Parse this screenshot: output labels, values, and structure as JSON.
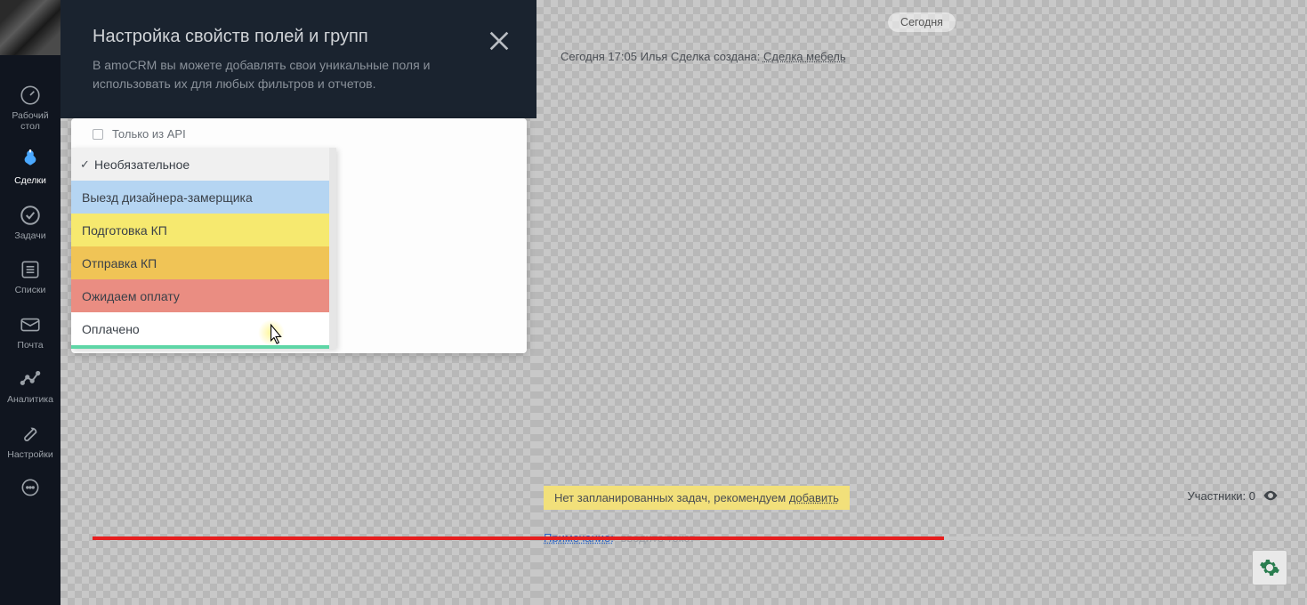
{
  "sidebar": {
    "items": [
      {
        "label": "Рабочий\nстол"
      },
      {
        "label": "Сделки"
      },
      {
        "label": "Задачи"
      },
      {
        "label": "Списки"
      },
      {
        "label": "Почта"
      },
      {
        "label": "Аналитика"
      },
      {
        "label": "Настройки"
      },
      {
        "label": ""
      }
    ]
  },
  "modal": {
    "title": "Настройка свойств полей и групп",
    "subtitle": "В amoCRM вы можете добавлять свои уникальные поля и использовать их для любых фильтров и отчетов."
  },
  "panel": {
    "api_only": "Только из API",
    "dropdown": [
      "Необязательное",
      "Выезд дизайнера-замерщика",
      "Подготовка КП",
      "Отправка КП",
      "Ожидаем оплату",
      "Оплачено"
    ]
  },
  "feed": {
    "today_badge": "Сегодня",
    "log_prefix": "Сегодня 17:05 Илья  Сделка создана: ",
    "log_link": "Сделка мебель",
    "no_tasks_prefix": "Нет запланированных задач, рекомендуем ",
    "no_tasks_link": "добавить",
    "participants_label": "Участники: 0",
    "note_label": "Примечание:",
    "note_placeholder": "введите текст"
  }
}
